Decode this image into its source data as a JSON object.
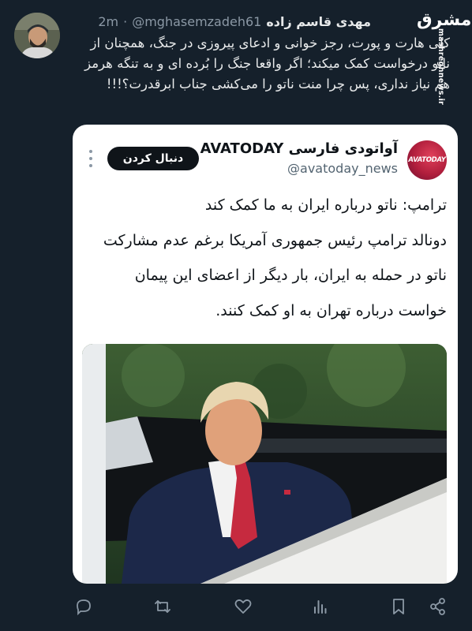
{
  "author": {
    "display_name": "مهدی قاسم زاده",
    "handle": "@mghasemzadeh61",
    "separator": "·",
    "time": "2m"
  },
  "tweet": {
    "text": "کلی هارت و پورت، رجز خوانی و ادعای پیروزی در جنگ، همچنان از ناتو درخواست کمک میکند؛ اگر واقعا جنگ را بُرده ای و به تنگه هرمز هم نیاز نداری، پس چرا منت ناتو را می‌کشی جناب ابرقدرت؟!!!"
  },
  "watermark": {
    "logo_text": "مشرق",
    "url": "mashreghnews.ir"
  },
  "quoted": {
    "logo_text": "AVATODAY",
    "name": "آواتودی فارسی AVATODAY",
    "handle": "@avatoday_news",
    "follow_label": "دنبال کردن",
    "headline": "ترامپ: ناتو درباره ایران به ما کمک کند",
    "body": "دونالد ترامپ رئیس جمهوری آمریکا برغم عدم مشارکت ناتو در حمله به ایران، بار دیگر از اعضای این پیمان خواست درباره تهران به او کمک کنند."
  },
  "actions": [
    "reply-icon",
    "retweet-icon",
    "like-icon",
    "views-icon",
    "bookmark-icon",
    "share-icon"
  ],
  "colors": {
    "background": "#15202b",
    "text": "#e7e9ea",
    "muted": "#8b98a5",
    "card": "#ffffff",
    "accent_red": "#c62a3f"
  }
}
